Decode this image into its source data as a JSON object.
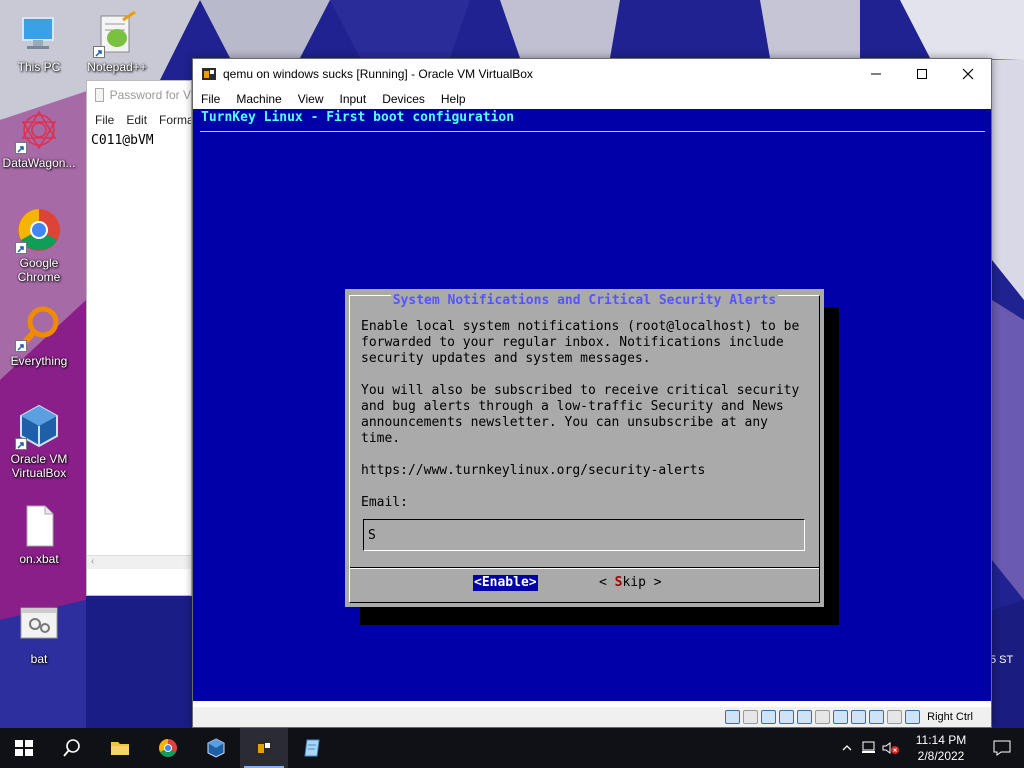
{
  "desktop": {
    "icons": [
      {
        "label": "This PC",
        "icon": "computer-icon"
      },
      {
        "label": "Notepad++",
        "icon": "notepadpp-icon"
      },
      {
        "label": "DataWagon...",
        "icon": "datawagon-icon"
      },
      {
        "label": "Google Chrome",
        "icon": "chrome-icon"
      },
      {
        "label": "Everything",
        "icon": "everything-icon"
      },
      {
        "label": "Oracle VM VirtualBox",
        "icon": "virtualbox-icon"
      },
      {
        "label": "on.xbat",
        "icon": "file-icon"
      },
      {
        "label": "bat",
        "icon": "settings-file-icon"
      }
    ],
    "edge_text": "5 ST"
  },
  "notepad": {
    "title": "Password for V",
    "menu": [
      "File",
      "Edit",
      "Forma"
    ],
    "content": "C011@bVM"
  },
  "vbox": {
    "title": "qemu on windows sucks [Running] - Oracle VM VirtualBox",
    "menu": [
      "File",
      "Machine",
      "View",
      "Input",
      "Devices",
      "Help"
    ],
    "host_key": "Right Ctrl"
  },
  "guest": {
    "backtitle": "TurnKey Linux - First boot configuration",
    "dialog": {
      "title": "System Notifications and Critical Security Alerts",
      "body": "Enable local system notifications (root@localhost) to be\nforwarded to your regular inbox. Notifications include\nsecurity updates and system messages.\n\nYou will also be subscribed to receive critical security\nand bug alerts through a low-traffic Security and News\nannouncements newsletter. You can unsubscribe at any\ntime.\n\nhttps://www.turnkeylinux.org/security-alerts\n\nEmail:",
      "email_value": "S",
      "enable_label": "<Enable>",
      "skip_prefix": "< ",
      "skip_hotkey": "S",
      "skip_rest": "kip >"
    },
    "colors": {
      "background": "#0000a8",
      "dialog": "#aaaaaa",
      "title": "#5555ff",
      "backtitle": "#55ffff"
    }
  },
  "taskbar": {
    "items": [
      "start-icon",
      "search-icon",
      "file-explorer-icon",
      "chrome-icon",
      "virtualbox-icon",
      "qemu-icon",
      "notepad-icon"
    ],
    "time": "11:14 PM",
    "date": "2/8/2022"
  }
}
